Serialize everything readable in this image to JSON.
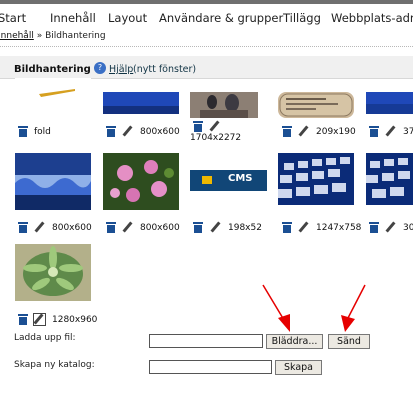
{
  "menu": [
    "Start",
    "Innehåll",
    "Layout",
    "Användare & grupper",
    "Tillägg",
    "Webbplats-adm"
  ],
  "breadcrumb": {
    "link": "Innehåll",
    "separator": "»",
    "current": "Bildhantering"
  },
  "header": {
    "title": "Bildhantering",
    "help_link": "Hjälp",
    "help_rest": "(nytt fönster)"
  },
  "images": [
    {
      "label": "fold"
    },
    {
      "label": "800x600"
    },
    {
      "label": "1704x2272"
    },
    {
      "label": "209x190"
    },
    {
      "label": "37"
    },
    {
      "label": "800x600"
    },
    {
      "label": "800x600"
    },
    {
      "label": "198x52",
      "logo_text": "CMS"
    },
    {
      "label": "1247x758"
    },
    {
      "label": "30"
    },
    {
      "label": "1280x960"
    }
  ],
  "upload": {
    "label": "Ladda upp fil:",
    "browse": "Bläddra...",
    "send": "Sänd"
  },
  "newdir": {
    "label": "Skapa ny katalog:",
    "button": "Skapa"
  },
  "colors": {
    "arrow": "#e60000",
    "thumb_blue": "#1a3a9c"
  }
}
